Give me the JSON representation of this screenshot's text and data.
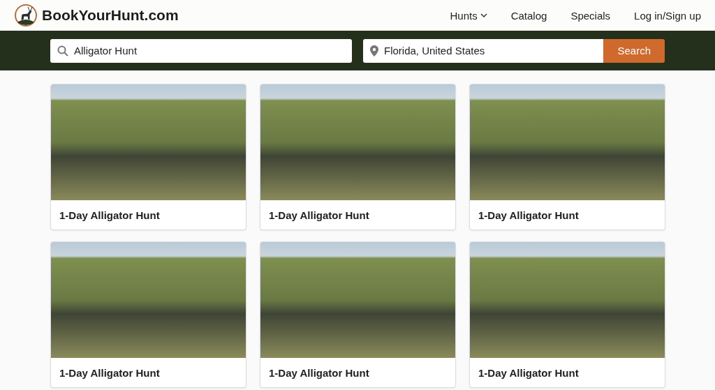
{
  "header": {
    "logo_text": "BookYourHunt.com",
    "nav": [
      {
        "label": "Hunts",
        "has_menu": true
      },
      {
        "label": "Catalog",
        "has_menu": false
      },
      {
        "label": "Specials",
        "has_menu": false
      },
      {
        "label": "Log in/Sign up",
        "has_menu": false
      }
    ]
  },
  "search_bar": {
    "query": "Alligator Hunt",
    "location": "Florida, United States",
    "button": "Search"
  },
  "listings": [
    {
      "title": "1-Day Alligator Hunt"
    },
    {
      "title": "1-Day Alligator Hunt"
    },
    {
      "title": "1-Day Alligator Hunt"
    },
    {
      "title": "1-Day Alligator Hunt"
    },
    {
      "title": "1-Day Alligator Hunt"
    },
    {
      "title": "1-Day Alligator Hunt"
    }
  ]
}
